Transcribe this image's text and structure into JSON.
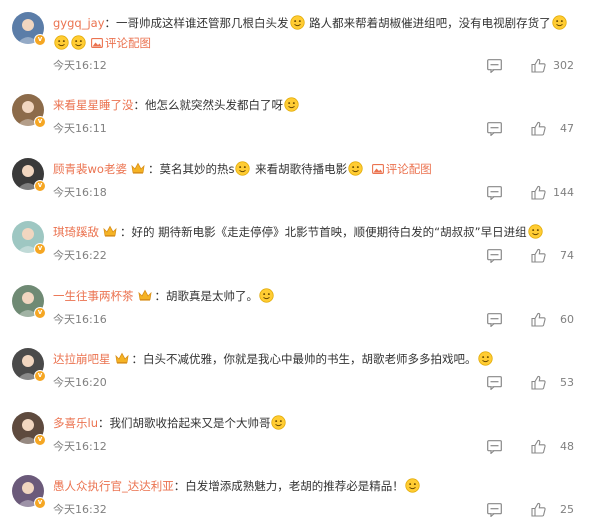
{
  "comments": [
    {
      "user": "gygq_jay",
      "has_crown": false,
      "segments": [
        "：一哥帅成这样谁还管那几根白头发",
        " 路人都来帮着胡椒催进组吧，没有电视剧存货了"
      ],
      "pic_link": "评论配图",
      "time": "今天16:12",
      "likes": "302",
      "avatar_color": "#5b7da8"
    },
    {
      "user": "来看星星睡了没",
      "has_crown": false,
      "segments": [
        "：他怎么就突然头发都白了呀"
      ],
      "pic_link": "",
      "time": "今天16:11",
      "likes": "47",
      "avatar_color": "#8c6b4a"
    },
    {
      "user": "顾青裴wo老婆",
      "has_crown": true,
      "segments": [
        "：莫名其妙的热s",
        " 来看胡歌待播电影"
      ],
      "pic_link": "评论配图",
      "time": "今天16:18",
      "likes": "144",
      "avatar_color": "#3a3a3a"
    },
    {
      "user": "琪琦蹊敌",
      "has_crown": true,
      "segments": [
        "：好的 期待新电影《走走停停》北影节首映，顺便期待白发的“胡叔叔”早日进组"
      ],
      "pic_link": "",
      "time": "今天16:22",
      "likes": "74",
      "avatar_color": "#9ec7c2"
    },
    {
      "user": "一生往事两杯茶",
      "has_crown": true,
      "segments": [
        "：胡歌真是太帅了。"
      ],
      "pic_link": "",
      "time": "今天16:16",
      "likes": "60",
      "avatar_color": "#6f8a74"
    },
    {
      "user": "达拉崩吧星",
      "has_crown": true,
      "segments": [
        "：白头不减优雅，你就是我心中最帅的书生，胡歌老师多多拍戏吧。"
      ],
      "pic_link": "",
      "time": "今天16:20",
      "likes": "53",
      "avatar_color": "#4a4a4a"
    },
    {
      "user": "多喜乐lu",
      "has_crown": false,
      "segments": [
        "：我们胡歌收拾起来又是个大帅哥"
      ],
      "pic_link": "",
      "time": "今天16:12",
      "likes": "48",
      "avatar_color": "#5e4a3e"
    },
    {
      "user": "愚人众执行官_达达利亚",
      "has_crown": false,
      "segments": [
        "：白发增添成熟魅力，老胡的推荐必是精品！"
      ],
      "pic_link": "",
      "time": "今天16:32",
      "likes": "25",
      "avatar_color": "#6b5a7a"
    }
  ],
  "colors": {
    "username": "#eb7350",
    "meta": "#808080",
    "badge": "#f5a623"
  },
  "icons": {
    "reply": "reply-icon",
    "like": "thumbs-up-icon",
    "crown": "crown-icon",
    "verified": "verified-badge-icon",
    "pic": "picture-icon"
  }
}
